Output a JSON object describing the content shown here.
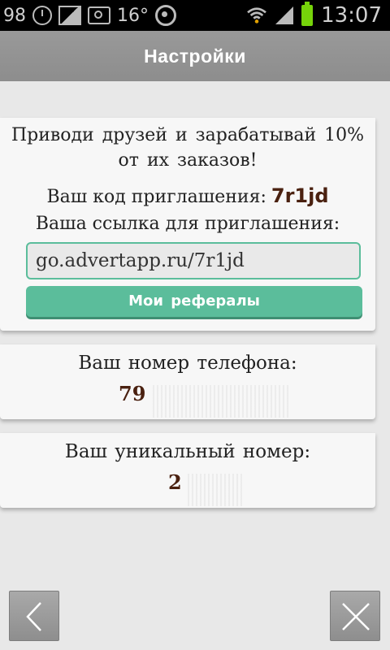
{
  "status_bar": {
    "battery_percent": "98",
    "temperature": "16°",
    "time": "13:07",
    "battery_color": "#76d40a"
  },
  "header": {
    "title": "Настройки"
  },
  "referral": {
    "promo_line1": "Приводи друзей и зарабатывай 10%",
    "promo_line2": "от их заказов!",
    "code_label": "Ваш код приглашения:",
    "code": "7r1jd",
    "link_label": "Ваша ссылка для приглашения:",
    "link_value": "go.advertapp.ru/7r1jd",
    "referrals_button": "Мои рефералы"
  },
  "phone": {
    "label": "Ваш номер телефона:",
    "value": "79"
  },
  "unique_id": {
    "label": "Ваш уникальный номер:",
    "value": "2"
  },
  "icons": {
    "back": "chevron-left-icon",
    "close": "close-icon"
  },
  "colors": {
    "accent": "#5bbd9b",
    "value_text": "#4a2110",
    "header_bg": "#949494"
  }
}
